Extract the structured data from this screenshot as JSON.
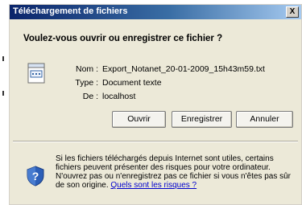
{
  "window": {
    "title": "Téléchargement de fichiers",
    "close_label": "X"
  },
  "dialog": {
    "question": "Voulez-vous ouvrir ou enregistrer ce fichier ?",
    "file": {
      "name_label": "Nom :",
      "name_value": "Export_Notanet_20-01-2009_15h43m59.txt",
      "type_label": "Type :",
      "type_value": "Document texte",
      "from_label": "De :",
      "from_value": "localhost"
    },
    "buttons": {
      "open": "Ouvrir",
      "save": "Enregistrer",
      "cancel": "Annuler"
    },
    "warning": {
      "text": "Si les fichiers téléchargés depuis Internet sont utiles, certains fichiers peuvent présenter des risques pour votre ordinateur. N'ouvrez pas ou n'enregistrez pas ce fichier si vous n'êtes pas sûr de son origine. ",
      "link": "Quels sont les risques ?"
    }
  },
  "colors": {
    "titlebar_start": "#0a246a",
    "titlebar_end": "#a6caf0",
    "dialog_bg": "#ece9d8",
    "link": "#0000cc"
  },
  "icons": {
    "file": "text-file-icon",
    "security": "shield-question-icon"
  }
}
